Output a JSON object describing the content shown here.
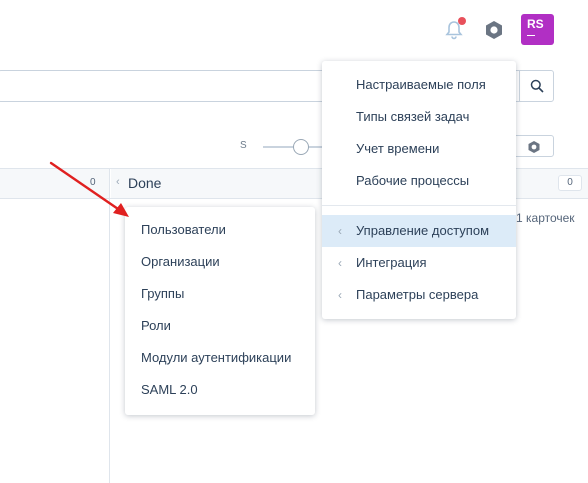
{
  "header": {
    "avatar_initials": "RS",
    "notification_badge_color": "#e8505b"
  },
  "toolbar": {
    "size_label": "S"
  },
  "board": {
    "left_column_count": "0",
    "right_column_title": "Done",
    "right_column_count": "0",
    "cards_count_text": "1 карточек"
  },
  "admin_menu": {
    "items": [
      {
        "label": "Настраиваемые поля"
      },
      {
        "label": "Типы связей задач"
      },
      {
        "label": "Учет времени"
      },
      {
        "label": "Рабочие процессы"
      },
      {
        "label": "Управление доступом",
        "active": true
      },
      {
        "label": "Интеграция"
      },
      {
        "label": "Параметры сервера"
      }
    ]
  },
  "access_submenu": {
    "items": [
      {
        "label": "Пользователи"
      },
      {
        "label": "Организации"
      },
      {
        "label": "Группы"
      },
      {
        "label": "Роли"
      },
      {
        "label": "Модули аутентификации"
      },
      {
        "label": "SAML 2.0"
      }
    ]
  },
  "colors": {
    "accent": "#b12fc4",
    "active_menu_bg": "#dcebf8",
    "annotation_arrow": "#e02020"
  }
}
